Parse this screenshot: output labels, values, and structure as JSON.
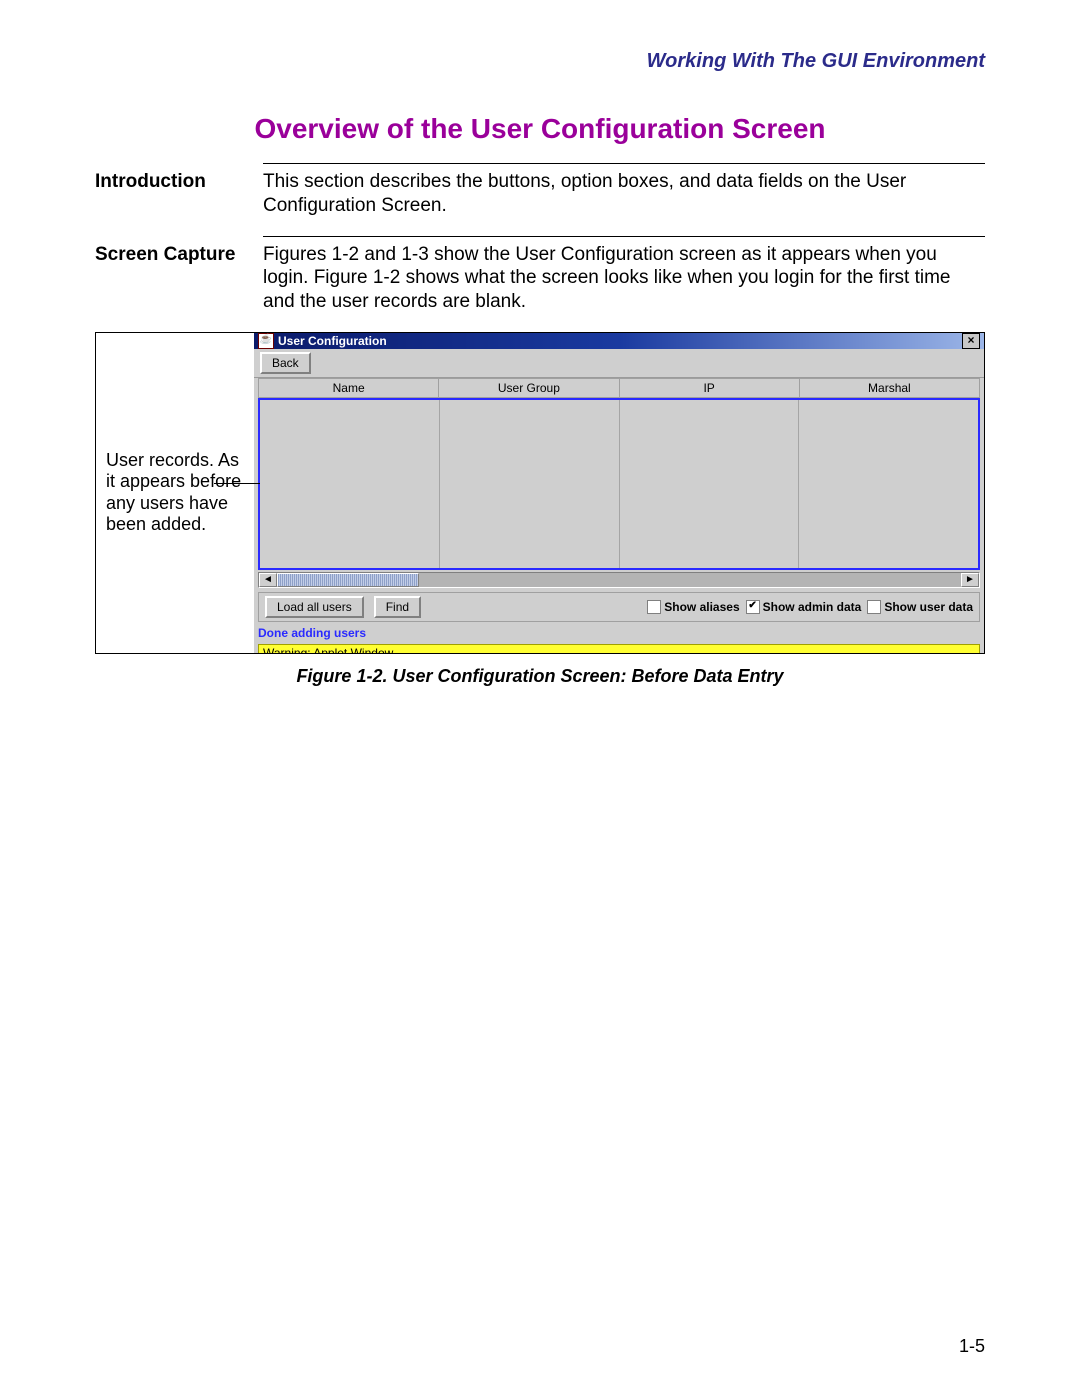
{
  "header": {
    "running": "Working With The GUI Environment",
    "title": "Overview of the User Configuration Screen"
  },
  "sections": {
    "intro": {
      "label": "Introduction",
      "body": "This section describes the buttons, option boxes, and data fields on the User Configuration Screen."
    },
    "capture": {
      "label": "Screen Capture",
      "body": "Figures 1-2 and 1-3 show the User Configuration screen as it appears when you login. Figure 1-2 shows what the screen looks like when you login for the first time and the user records are blank."
    }
  },
  "callout": "User records. As it appears before any users have been added.",
  "window": {
    "title": "User Configuration",
    "back": "Back",
    "columns": [
      "Name",
      "User Group",
      "IP",
      "Marshal"
    ],
    "load_all": "Load all users",
    "find": "Find",
    "show_aliases": {
      "label": "Show aliases",
      "checked": false
    },
    "show_admin": {
      "label": "Show admin data",
      "checked": true
    },
    "show_user": {
      "label": "Show user data",
      "checked": false
    },
    "status": "Done adding users",
    "applet_warning": "Warning: Applet Window"
  },
  "figure_caption": "Figure 1-2. User Configuration Screen: Before Data Entry",
  "page_number": "1-5"
}
